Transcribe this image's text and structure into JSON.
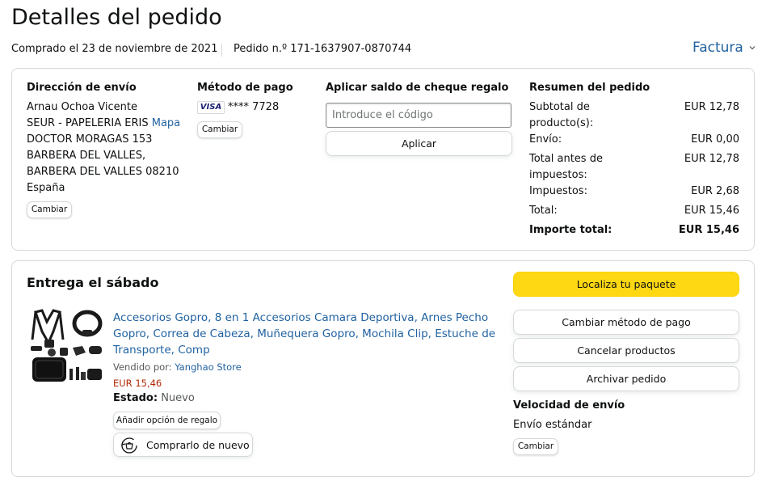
{
  "page": {
    "title": "Detalles del pedido",
    "purchased": "Comprado el 23 de noviembre de 2021",
    "order_number": "Pedido n.º 171-1637907-0870744",
    "invoice": "Factura"
  },
  "shipping": {
    "heading": "Dirección de envío",
    "name": "Arnau Ochoa Vicente",
    "line1": "SEUR - PAPELERIA ERIS",
    "map_link": "Mapa",
    "line2": "DOCTOR MORAGAS 153",
    "line3": "BARBERA DEL VALLES,",
    "line4": "BARBERA DEL VALLES 08210",
    "country": "España",
    "change": "Cambiar"
  },
  "payment": {
    "heading": "Método de pago",
    "card_brand": "VISA",
    "card_number": "**** 7728",
    "change": "Cambiar"
  },
  "gift_card": {
    "heading": "Aplicar saldo de cheque regalo",
    "placeholder": "Introduce el código",
    "apply": "Aplicar"
  },
  "summary": {
    "heading": "Resumen del pedido",
    "subtotal_label_1": "Subtotal de",
    "subtotal_label_2": "producto(s):",
    "subtotal_value": "EUR 12,78",
    "shipping_label": "Envío:",
    "shipping_value": "EUR 0,00",
    "pretax_label_1": "Total antes de",
    "pretax_label_2": "impuestos:",
    "pretax_value": "EUR 12,78",
    "tax_label": "Impuestos:",
    "tax_value": "EUR 2,68",
    "total_label": "Total:",
    "total_value": "EUR 15,46",
    "grand_total_label": "Importe total:",
    "grand_total_value": "EUR 15,46"
  },
  "delivery": {
    "heading": "Entrega el sábado",
    "product_title_1": "Accesorios Gopro, 8 en 1 Accesorios Camara Deportiva, Arnes Pecho",
    "product_title_2": "Gopro, Correa de Cabeza, Muñequera Gopro, Mochila Clip, Estuche de",
    "product_title_3": "Transporte, Comp",
    "sold_by_label": "Vendido por:",
    "seller": "Yanghao Store",
    "price": "EUR 15,46",
    "condition_label": "Estado:",
    "condition_value": "Nuevo",
    "gift_option": "Añadir opción de regalo",
    "buy_again": "Comprarlo de nuevo"
  },
  "actions": {
    "track": "Localiza tu paquete",
    "change_payment": "Cambiar método de pago",
    "cancel": "Cancelar productos",
    "archive": "Archivar pedido",
    "speed_heading": "Velocidad de envío",
    "speed_value": "Envío estándar",
    "change": "Cambiar"
  },
  "colors": {
    "link": "#2162A1",
    "price": "#B12704",
    "yellow_button": "#FFD814",
    "border": "#D5D9D9",
    "text": "#0F1111"
  }
}
